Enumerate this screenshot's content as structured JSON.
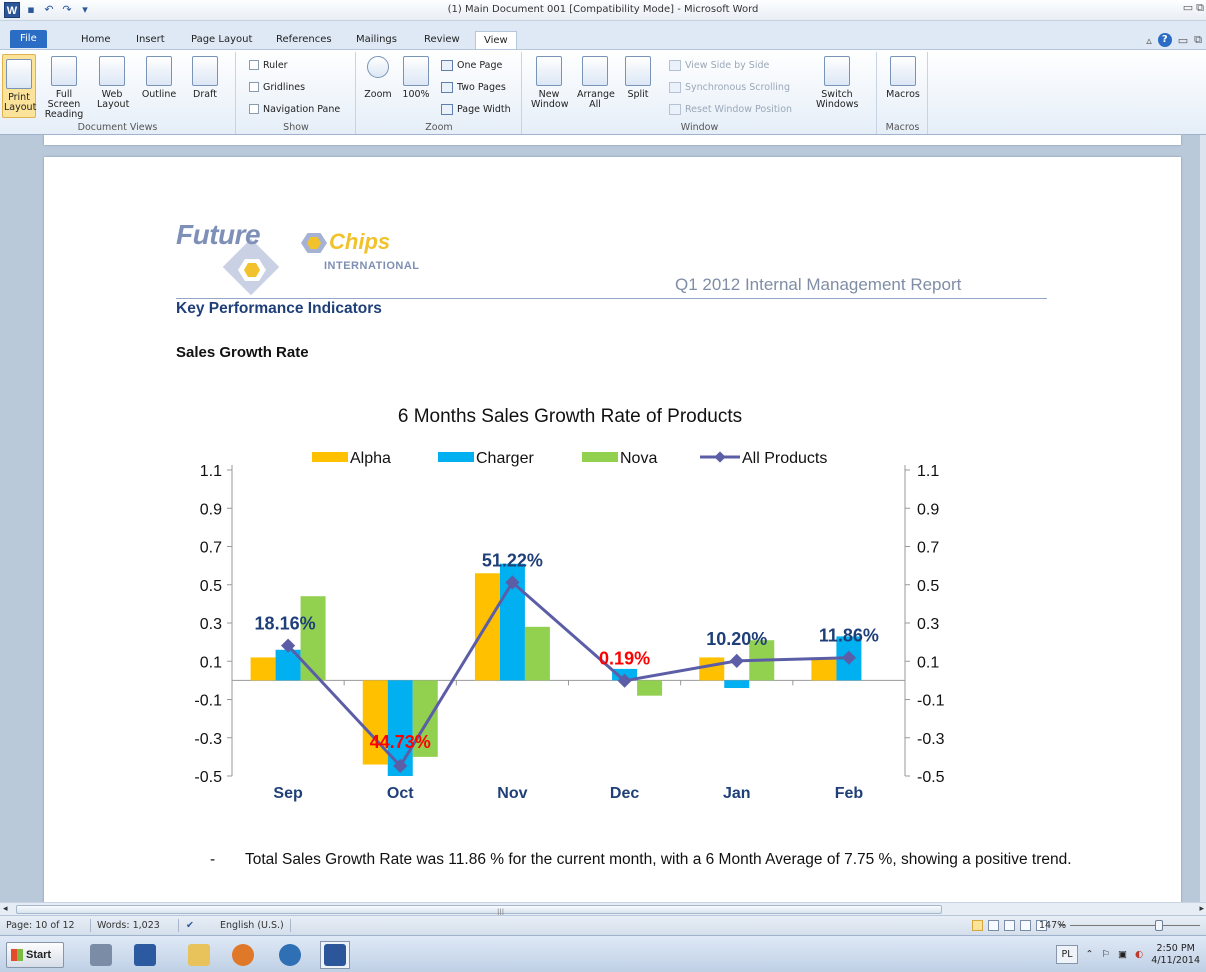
{
  "window": {
    "title": "(1) Main Document 001 [Compatibility Mode] - Microsoft Word",
    "word_icon_letter": "W"
  },
  "ribbon_tabs": [
    "File",
    "Home",
    "Insert",
    "Page Layout",
    "References",
    "Mailings",
    "Review",
    "View"
  ],
  "active_tab": "View",
  "ribbon": {
    "document_views": {
      "label": "Document Views",
      "buttons": [
        "Print Layout",
        "Full Screen Reading",
        "Web Layout",
        "Outline",
        "Draft"
      ]
    },
    "show": {
      "label": "Show",
      "items": [
        "Ruler",
        "Gridlines",
        "Navigation Pane"
      ]
    },
    "zoom": {
      "label": "Zoom",
      "zoom_btn": "Zoom",
      "hundred_btn": "100%",
      "one_page": "One Page",
      "two_pages": "Two Pages",
      "page_width": "Page Width"
    },
    "window": {
      "label": "Window",
      "new_window": "New Window",
      "arrange_all": "Arrange All",
      "split": "Split",
      "view_side": "View Side by Side",
      "sync_scroll": "Synchronous Scrolling",
      "reset_pos": "Reset Window Position",
      "switch_windows": "Switch Windows"
    },
    "macros": {
      "label": "Macros",
      "button": "Macros"
    }
  },
  "document": {
    "logo": {
      "future": "Future",
      "chips": "Chips",
      "intl": "INTERNATIONAL"
    },
    "report_title": "Q1 2012 Internal Management Report",
    "kpi_heading": "Key Performance Indicators",
    "section_heading": "Sales Growth Rate",
    "bullet_dash": "-",
    "bullet_text": "Total Sales Growth Rate was 11.86 % for the current month, with a 6 Month Average of 7.75 %, showing a positive trend."
  },
  "chart_data": {
    "type": "bar",
    "title": "6 Months Sales Growth Rate of Products",
    "categories": [
      "Sep",
      "Oct",
      "Nov",
      "Dec",
      "Jan",
      "Feb"
    ],
    "series": [
      {
        "name": "Alpha",
        "color": "#ffc000",
        "values": [
          0.12,
          -0.44,
          0.56,
          0.0,
          0.12,
          0.11
        ]
      },
      {
        "name": "Charger",
        "color": "#00b0f0",
        "values": [
          0.16,
          -0.5,
          0.61,
          0.06,
          -0.04,
          0.23
        ]
      },
      {
        "name": "Nova",
        "color": "#92d050",
        "values": [
          0.44,
          -0.4,
          0.28,
          -0.08,
          0.21,
          0.0
        ]
      }
    ],
    "line_series": {
      "name": "All Products",
      "color": "#5b5ea6",
      "values": [
        0.1816,
        -0.4473,
        0.5122,
        -0.0019,
        0.102,
        0.1186
      ]
    },
    "data_labels": [
      {
        "text": "18.16%",
        "color": "#1f3f78"
      },
      {
        "text": "44.73%",
        "color": "#ff0000"
      },
      {
        "text": "51.22%",
        "color": "#1f3f78"
      },
      {
        "text": "0.19%",
        "color": "#ff0000"
      },
      {
        "text": "10.20%",
        "color": "#1f3f78"
      },
      {
        "text": "11.86%",
        "color": "#1f3f78"
      }
    ],
    "y_ticks": [
      "1.1",
      "0.9",
      "0.7",
      "0.5",
      "0.3",
      "0.1",
      "-0.1",
      "-0.3",
      "-0.5"
    ],
    "ylim": [
      -0.5,
      1.1
    ],
    "legend_position": "top",
    "grid": false
  },
  "statusbar": {
    "page": "Page: 10 of 12",
    "words": "Words: 1,023",
    "language": "English (U.S.)",
    "zoom": "147%"
  },
  "taskbar": {
    "start": "Start",
    "lang": "PL",
    "time": "2:50 PM",
    "date": "4/11/2014"
  }
}
